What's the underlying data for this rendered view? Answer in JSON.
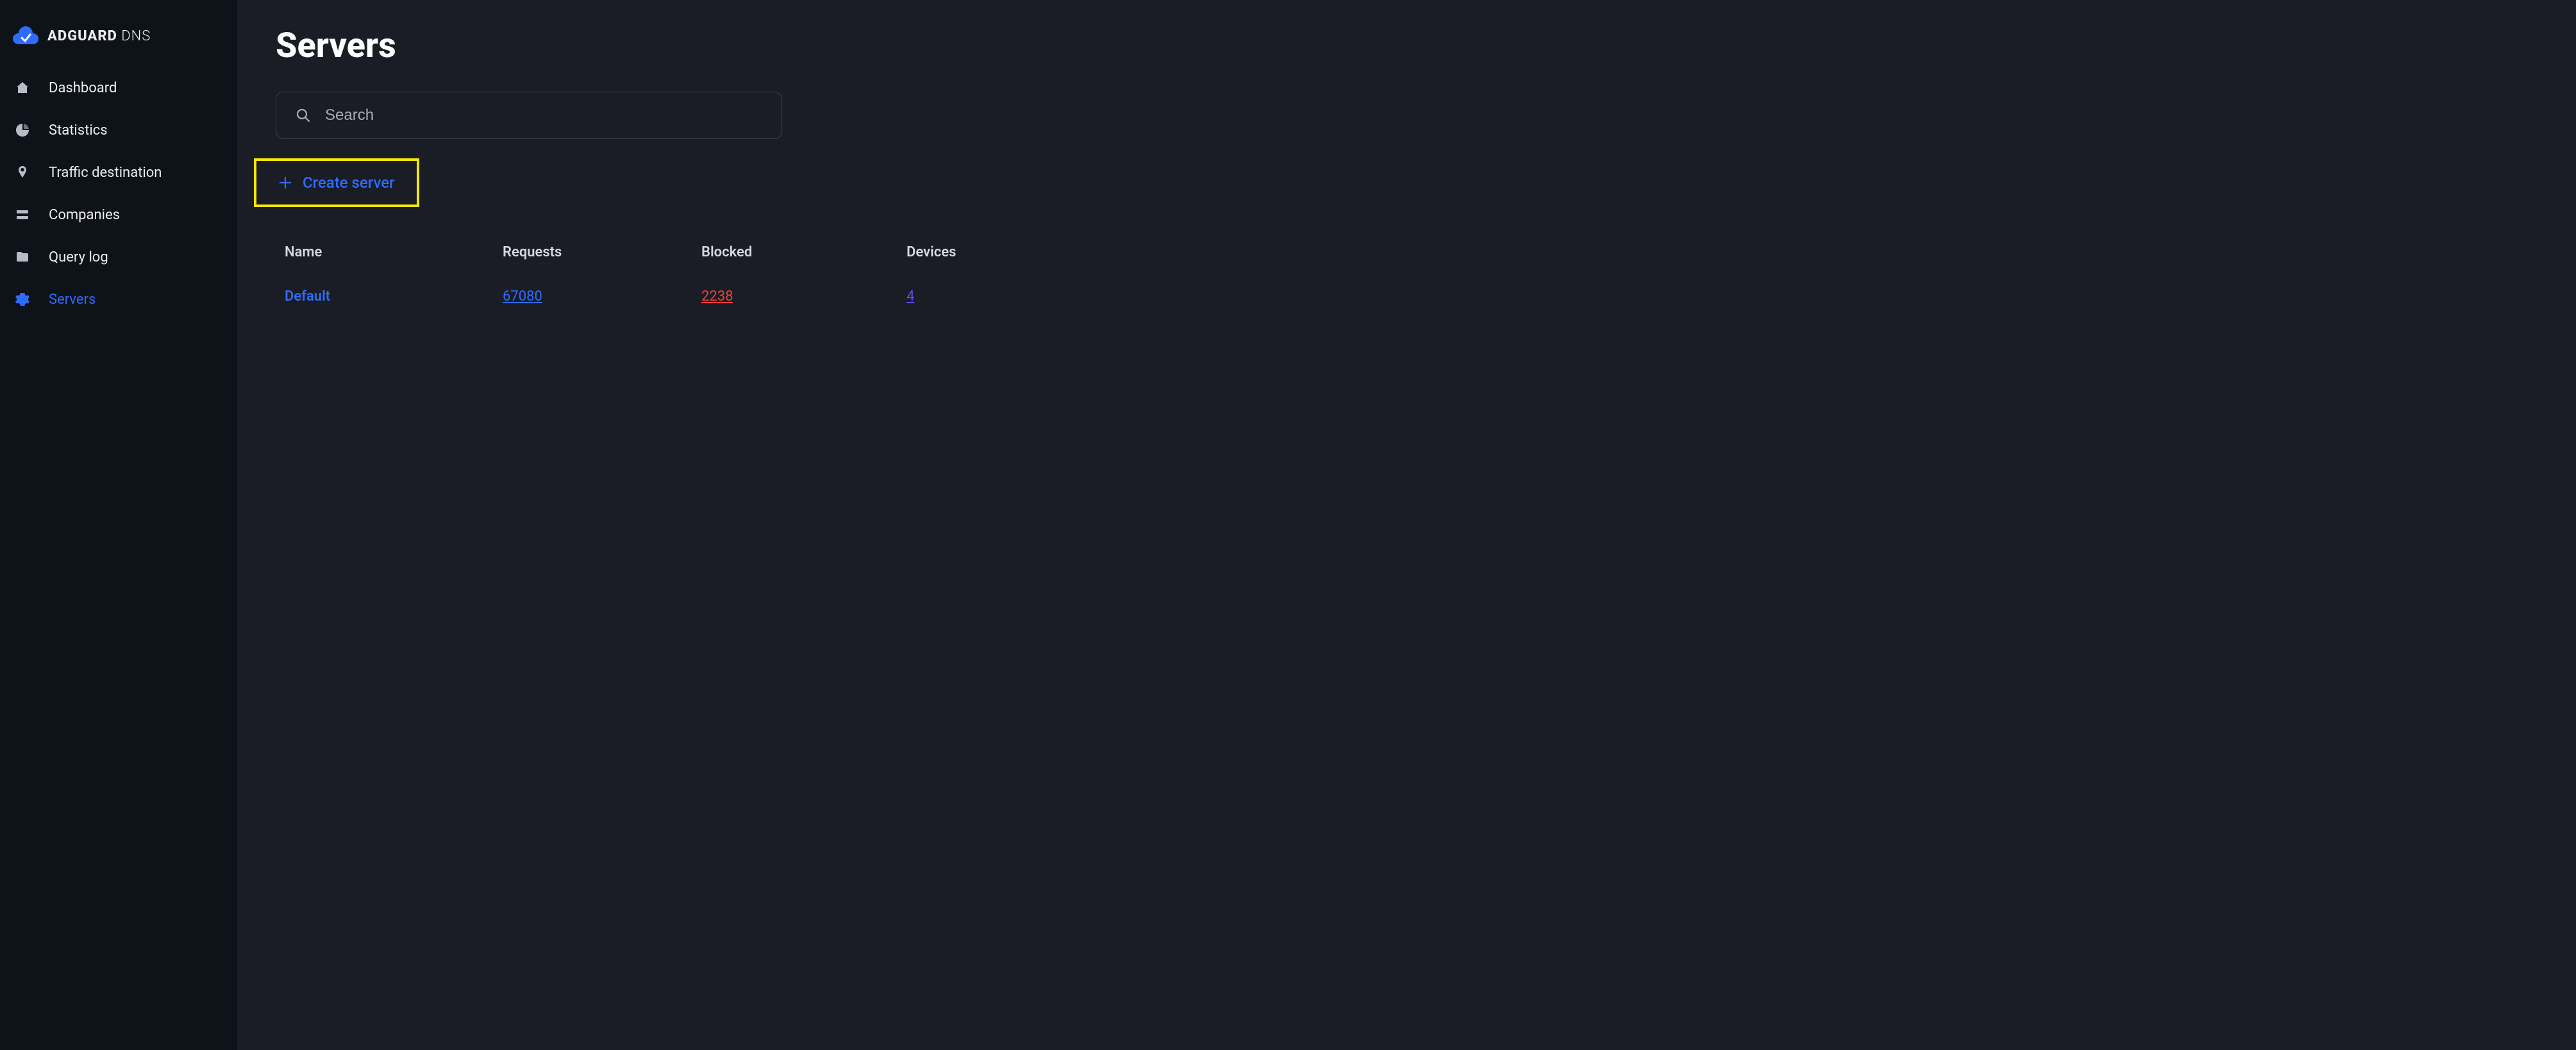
{
  "brand": {
    "bold": "ADGUARD",
    "thin": " DNS"
  },
  "sidebar": {
    "items": [
      {
        "label": "Dashboard",
        "icon": "home-icon",
        "active": false
      },
      {
        "label": "Statistics",
        "icon": "pie-icon",
        "active": false
      },
      {
        "label": "Traffic destination",
        "icon": "pin-icon",
        "active": false
      },
      {
        "label": "Companies",
        "icon": "stack-icon",
        "active": false
      },
      {
        "label": "Query log",
        "icon": "folder-icon",
        "active": false
      },
      {
        "label": "Servers",
        "icon": "gear-icon",
        "active": true
      }
    ]
  },
  "page": {
    "title": "Servers",
    "search_placeholder": "Search",
    "create_label": "Create server"
  },
  "table": {
    "headers": {
      "name": "Name",
      "requests": "Requests",
      "blocked": "Blocked",
      "devices": "Devices"
    },
    "rows": [
      {
        "name": "Default",
        "requests": "67080",
        "blocked": "2238",
        "devices": "4"
      }
    ]
  },
  "colors": {
    "accent": "#2e6cff",
    "danger": "#e8413a",
    "purple": "#6a4dff",
    "highlight_box": "#f5e900"
  }
}
